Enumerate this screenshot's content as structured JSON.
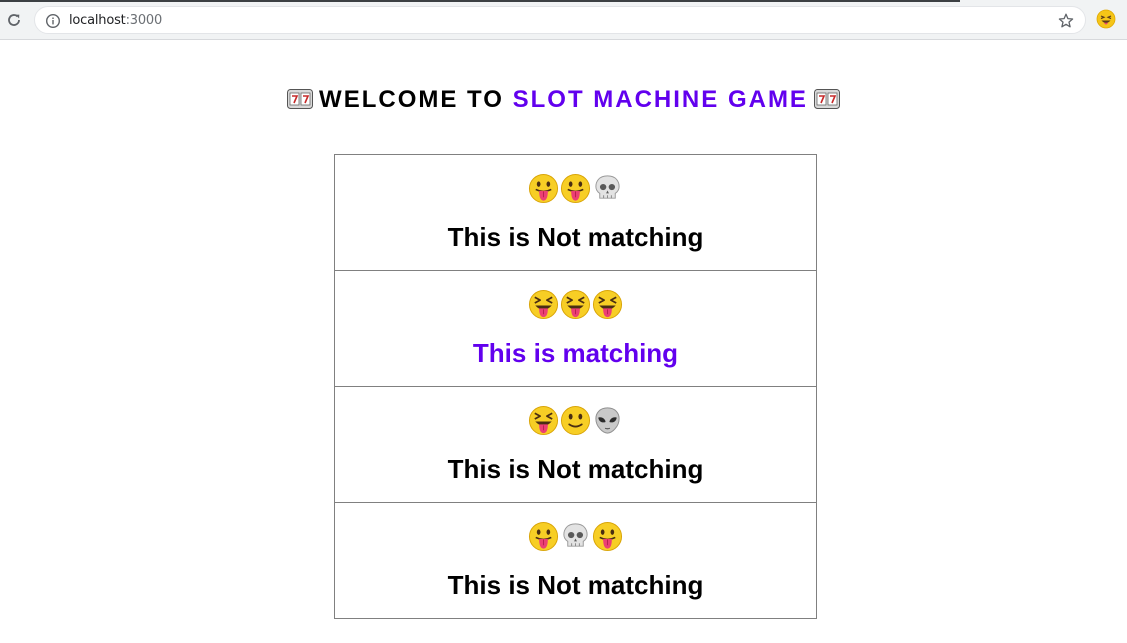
{
  "browser": {
    "url_host": "localhost",
    "url_port": ":3000"
  },
  "heading": {
    "prefix": "WELCOME TO ",
    "accent": "SLOT MACHINE GAME",
    "accent_color": "#6200ee",
    "icon": "slot-machine-icon"
  },
  "rows": [
    {
      "reels": [
        "face-tongue",
        "face-tongue",
        "skull"
      ],
      "result": "This is Not matching",
      "matching": false
    },
    {
      "reels": [
        "squint-tongue",
        "squint-tongue",
        "squint-tongue"
      ],
      "result": "This is matching",
      "matching": true
    },
    {
      "reels": [
        "squint-tongue",
        "slight-smile",
        "alien"
      ],
      "result": "This is Not matching",
      "matching": false
    },
    {
      "reels": [
        "face-tongue",
        "skull",
        "face-tongue"
      ],
      "result": "This is Not matching",
      "matching": false
    }
  ]
}
